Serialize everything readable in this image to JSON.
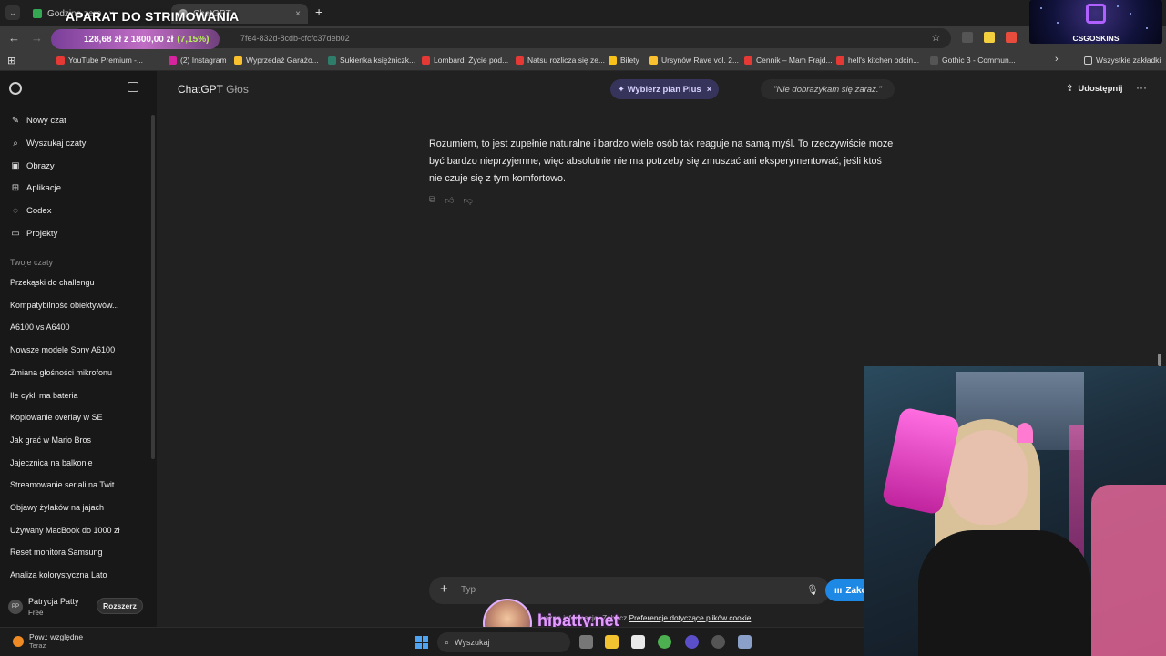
{
  "browser": {
    "tabs": [
      {
        "label": "Godzina zero",
        "close": "×"
      },
      {
        "label": "ChatGPT",
        "close": "×"
      }
    ],
    "new_tab": "+",
    "overlay_title": "APARAT DO STRIMOWANIA",
    "url_tail": "7fe4-832d-8cdb-cfcfc37deb02",
    "balance": {
      "text": "128,68 zł z 1800,00 zł",
      "percent": "(7,15%)"
    },
    "bookmarks": [
      {
        "label": "YouTube Premium -...",
        "color": "#e53935"
      },
      {
        "label": "(2) Instagram",
        "color": "#d6249f"
      },
      {
        "label": "Wyprzedaż Garażo...",
        "color": "#fbc02d"
      },
      {
        "label": "Sukienka księżniczk...",
        "color": "#2e7d6b"
      },
      {
        "label": "Lombard. Życie pod...",
        "color": "#e53935"
      },
      {
        "label": "Natsu rozlicza się ze...",
        "color": "#e53935"
      },
      {
        "label": "Bilety",
        "color": "#f9c21a"
      },
      {
        "label": "Ursynów Rave vol. 2...",
        "color": "#fbc02d"
      },
      {
        "label": "Cennik – Mam Frajd...",
        "color": "#e53935"
      },
      {
        "label": "hell's kitchen odcin...",
        "color": "#e53935"
      },
      {
        "label": "Gothic 3 - Commun...",
        "color": "#555555"
      }
    ],
    "all_bookmarks": "Wszystkie zakładki",
    "stream_badge": "CSGOSKINS"
  },
  "sidebar": {
    "menu": [
      {
        "label": "Nowy czat",
        "icon": "✎"
      },
      {
        "label": "Wyszukaj czaty",
        "icon": "⌕"
      },
      {
        "label": "Obrazy",
        "icon": "▣"
      },
      {
        "label": "Aplikacje",
        "icon": "⊞"
      },
      {
        "label": "Codex",
        "icon": "◌"
      },
      {
        "label": "Projekty",
        "icon": "▭"
      }
    ],
    "section_title": "Twoje czaty",
    "chats": [
      "Przekąski do challengu",
      "Kompatybilność obiektywów...",
      "A6100 vs A6400",
      "Nowsze modele Sony A6100",
      "Zmiana głośności mikrofonu",
      "Ile cykli ma bateria",
      "Kopiowanie overlay w SE",
      "Jak grać w Mario Bros",
      "Jajecznica na balkonie",
      "Streamowanie seriali na Twit...",
      "Objawy żylaków na jajach",
      "Używany MacBook do 1000 zł",
      "Reset monitora Samsung",
      "Analiza kolorystyczna Lato"
    ],
    "user": {
      "initials": "PP",
      "name": "Patrycja Patty",
      "plan": "Free",
      "upgrade": "Rozszerz"
    }
  },
  "header": {
    "title": "ChatGPT",
    "subtitle": "Głos",
    "plus_button": "✦ Wybierz plan Plus",
    "plus_close": "×",
    "voice_caption": "\"Nie dobrazykam się zaraz.\"",
    "share": "Udostępnij",
    "more": "···"
  },
  "message": {
    "text": "Rozumiem, to jest zupełnie naturalne i bardzo wiele osób tak reaguje na samą myśl. To rzeczywiście może być bardzo nieprzyjemne, więc absolutnie nie ma potrzeby się zmuszać ani eksperymentować, jeśli ktoś nie czuje się z tym komfortowo."
  },
  "composer": {
    "placeholder": "Typ",
    "plus": "+",
    "end_button": "Zako",
    "footer_prefix": "...ważne informacje. Zobacz ",
    "footer_link": "Preferencje dotyczące plików cookie",
    "footer_suffix": "."
  },
  "stream": {
    "watermark": "hipatty.net"
  },
  "taskbar": {
    "weather_line1": "Pow.: względne",
    "weather_line2": "Teraz",
    "search_label": "Wyszukaj"
  },
  "colors": {
    "accent_plus": "#37345c",
    "end_button": "#1e88e5",
    "background": "#212121",
    "sidebar": "#181818"
  }
}
